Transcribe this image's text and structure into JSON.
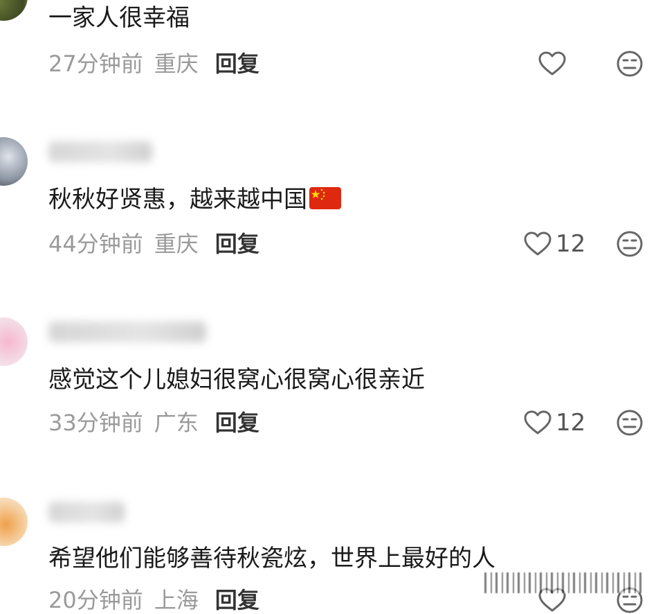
{
  "comments": [
    {
      "text": "一家人很幸福",
      "time": "27分钟前",
      "location": "重庆",
      "reply": "回复",
      "likes": ""
    },
    {
      "text": "秋秋好贤惠，越来越中国",
      "time": "44分钟前",
      "location": "重庆",
      "reply": "回复",
      "likes": "12"
    },
    {
      "text": "感觉这个儿媳妇很窝心很窝心很亲近",
      "time": "33分钟前",
      "location": "广东",
      "reply": "回复",
      "likes": "12"
    },
    {
      "text": "希望他们能够善待秋瓷炫，世界上最好的人",
      "time": "20分钟前",
      "location": "上海",
      "reply": "回复",
      "likes": ""
    }
  ],
  "icons": {
    "like": "heart-outline-icon",
    "dislike": "neutral-face-icon",
    "flag": "china-flag-emoji"
  },
  "colors": {
    "text": "#1a1a1a",
    "meta": "#9a9a9a",
    "reply": "#333333",
    "icon": "#666666",
    "flag_red": "#de2910",
    "flag_star": "#ffde00"
  }
}
